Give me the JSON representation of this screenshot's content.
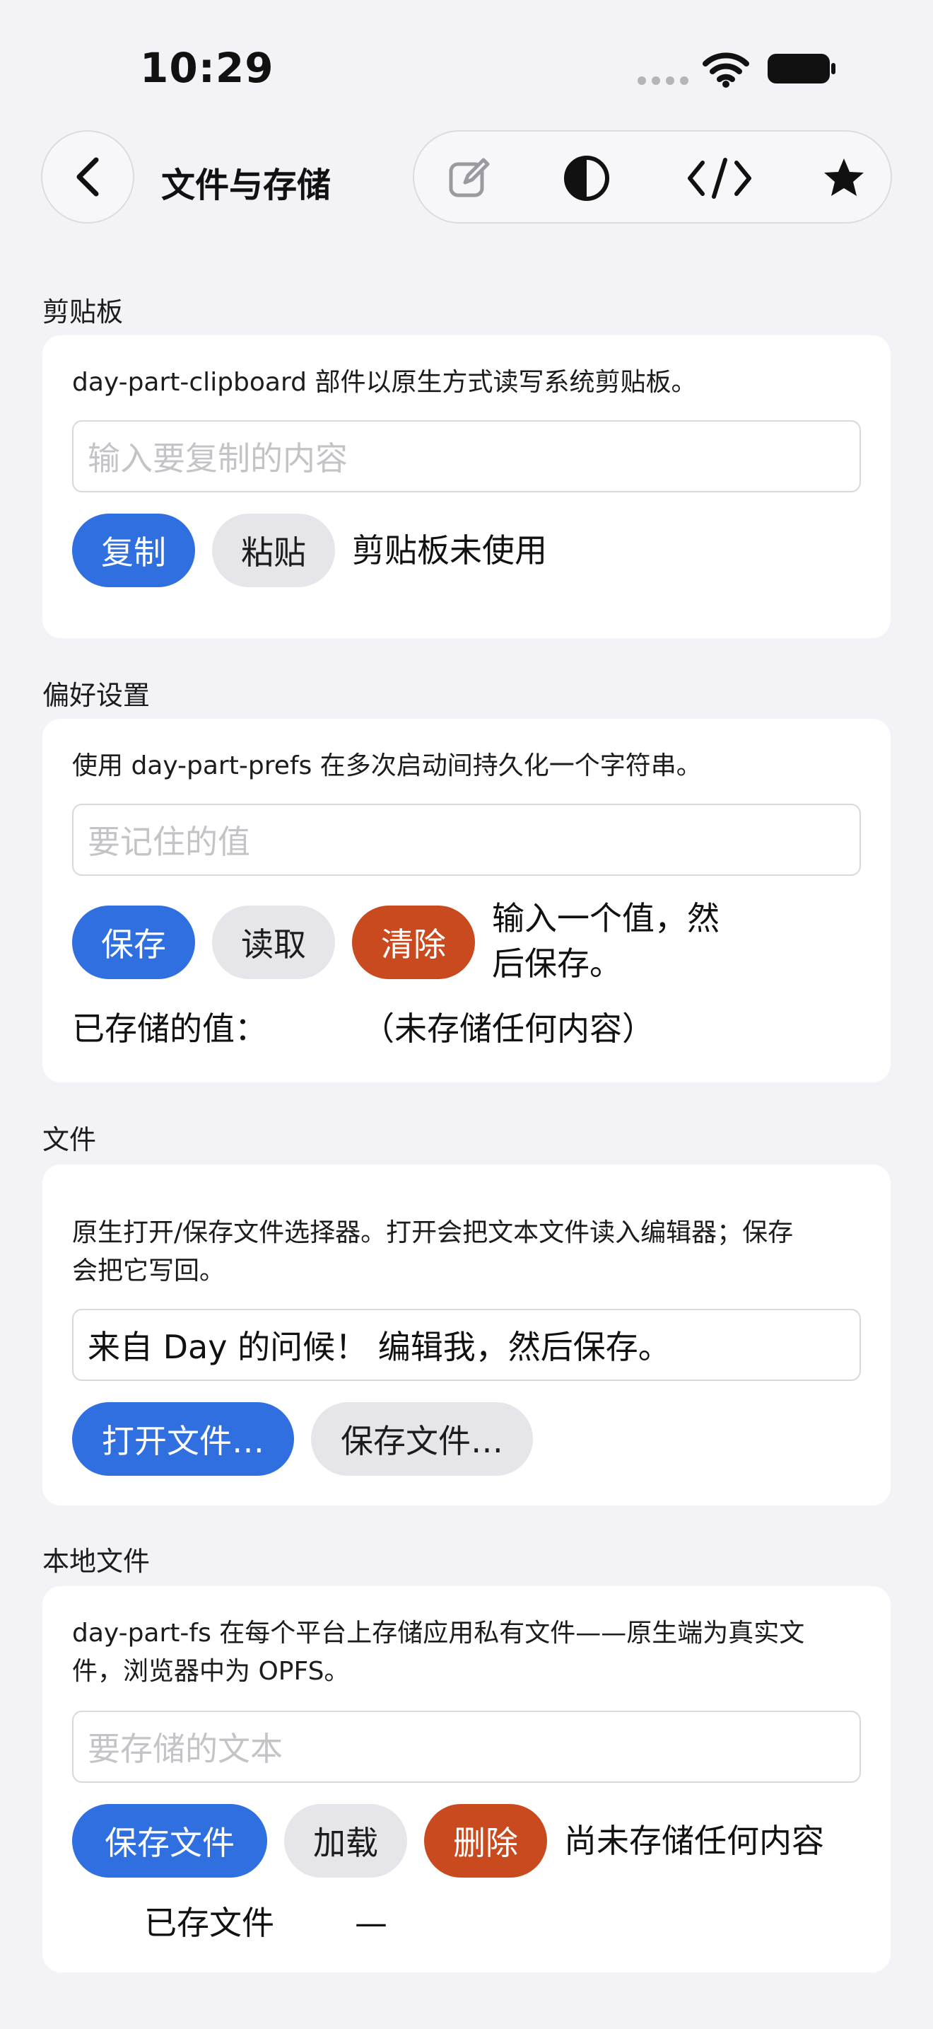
{
  "status_bar": {
    "time": "10:29"
  },
  "nav": {
    "title": "文件与存储",
    "toolbar_icons": [
      "compose-icon",
      "contrast-icon",
      "code-icon",
      "star-icon"
    ]
  },
  "clipboard": {
    "section_label": "剪贴板",
    "description": "day-part-clipboard 部件以原生方式读写系统剪贴板。",
    "input_placeholder": "输入要复制的内容",
    "copy_label": "复制",
    "paste_label": "粘贴",
    "status": "剪贴板未使用"
  },
  "prefs": {
    "section_label": "偏好设置",
    "description": "使用 day-part-prefs 在多次启动间持久化一个字符串。",
    "input_placeholder": "要记住的值",
    "save_label": "保存",
    "read_label": "读取",
    "clear_label": "清除",
    "status_line1": "输入一个值，然",
    "status_line2": "后保存。",
    "stored_label": "已存储的值：",
    "stored_value": "（未存储任何内容）"
  },
  "files": {
    "section_label": "文件",
    "description_line1": "原生打开/保存文件选择器。打开会把文本文件读入编辑器；保存",
    "description_line2": "会把它写回。",
    "editor_value": "来自 Day 的问候！ 编辑我，然后保存。",
    "open_label": "打开文件…",
    "save_label": "保存文件…"
  },
  "local_files": {
    "section_label": "本地文件",
    "description_line1": "day-part-fs 在每个平台上存储应用私有文件——原生端为真实文",
    "description_line2": "件，浏览器中为 OPFS。",
    "input_placeholder": "要存储的文本",
    "save_label": "保存文件",
    "load_label": "加载",
    "delete_label": "删除",
    "status": "尚未存储任何内容",
    "saved_file_label": "已存文件",
    "saved_file_value": "—"
  },
  "colors": {
    "accent_blue": "#2f6fe0",
    "destructive_red": "#c94a1e",
    "secondary_gray": "#e6e6ea",
    "background": "#f2f2f7"
  }
}
